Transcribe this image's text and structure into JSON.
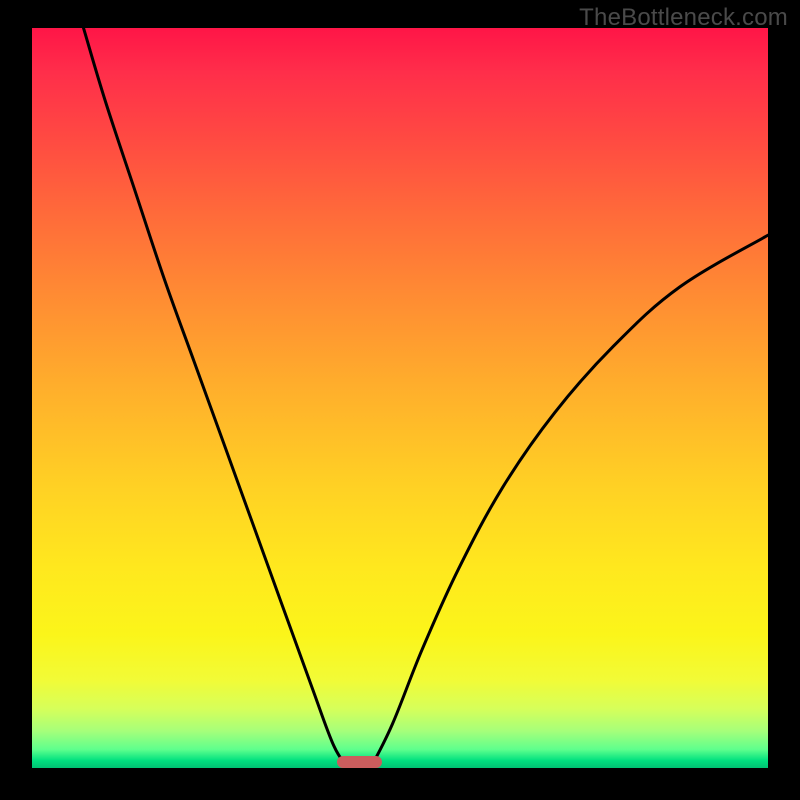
{
  "watermark": "TheBottleneck.com",
  "colors": {
    "page_bg": "#000000",
    "curve": "#000000",
    "marker": "#ca5d5d",
    "gradient_top": "#ff1547",
    "gradient_mid": "#ffd124",
    "gradient_bottom": "#00c273"
  },
  "chart_data": {
    "type": "line",
    "title": "",
    "xlabel": "",
    "ylabel": "",
    "xlim": [
      0,
      100
    ],
    "ylim": [
      0,
      100
    ],
    "grid": false,
    "legend": false,
    "note": "Two curved branches descending to a minimum near x≈43 (y≈0) and rising toward the edges. Y roughly represents bottleneck severity (red high, green low).",
    "left_branch": [
      {
        "x": 7,
        "y": 100
      },
      {
        "x": 10,
        "y": 90
      },
      {
        "x": 14,
        "y": 78
      },
      {
        "x": 18,
        "y": 66
      },
      {
        "x": 22,
        "y": 55
      },
      {
        "x": 26,
        "y": 44
      },
      {
        "x": 30,
        "y": 33
      },
      {
        "x": 34,
        "y": 22
      },
      {
        "x": 38,
        "y": 11
      },
      {
        "x": 41,
        "y": 3
      },
      {
        "x": 43,
        "y": 0
      }
    ],
    "right_branch": [
      {
        "x": 46,
        "y": 0
      },
      {
        "x": 49,
        "y": 6
      },
      {
        "x": 53,
        "y": 16
      },
      {
        "x": 58,
        "y": 27
      },
      {
        "x": 64,
        "y": 38
      },
      {
        "x": 71,
        "y": 48
      },
      {
        "x": 79,
        "y": 57
      },
      {
        "x": 88,
        "y": 65
      },
      {
        "x": 100,
        "y": 72
      }
    ],
    "marker": {
      "x_center": 44.5,
      "width": 6,
      "y": 0.8,
      "height": 1.6
    }
  }
}
